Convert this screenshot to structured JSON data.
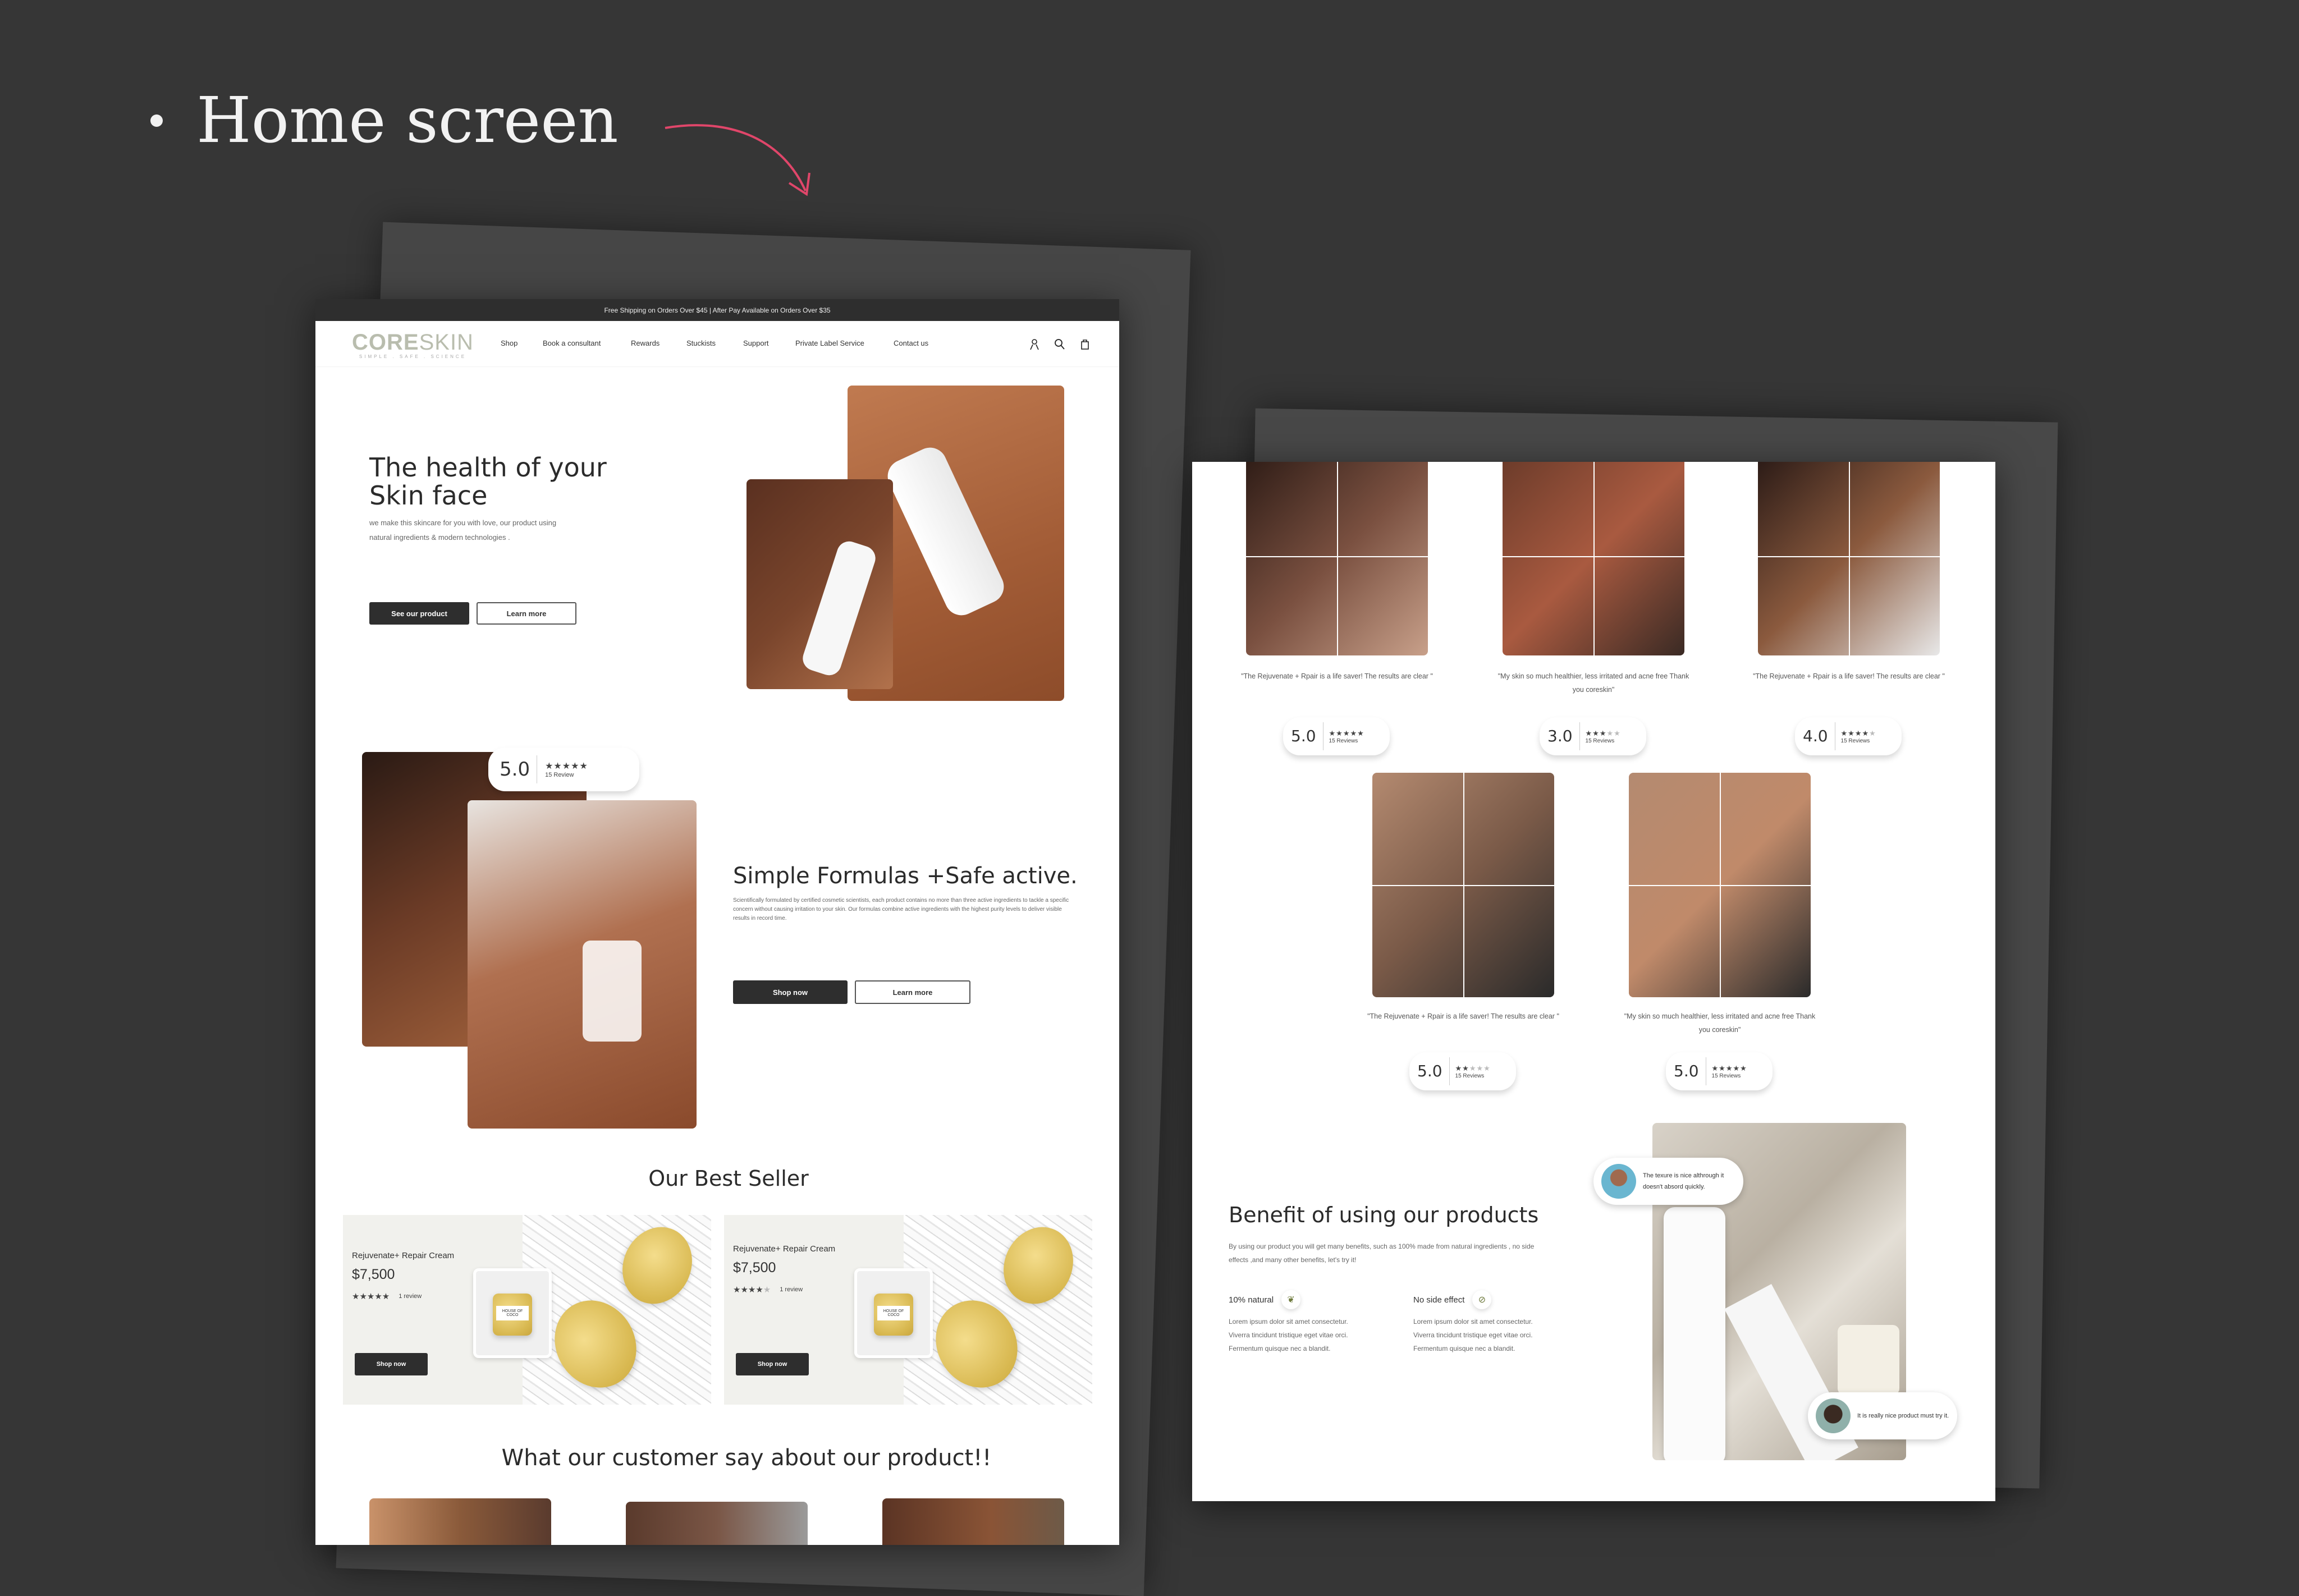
{
  "slide": {
    "title": "Home screen",
    "accent": "#e0466a"
  },
  "home": {
    "announcement": "Free Shipping on Orders Over $45 | After Pay Available on Orders Over $35",
    "logo": {
      "bold": "CORE",
      "light": "SKIN",
      "tagline": "SIMPLE . SAFE . SCIENCE"
    },
    "nav": [
      "Shop",
      "Book a consultant",
      "Rewards",
      "Stuckists",
      "Support",
      "Private Label Service",
      "Contact us"
    ],
    "icons": [
      "user-icon",
      "search-icon",
      "bag-icon"
    ],
    "hero": {
      "title_line1": "The health of your",
      "title_line2": "Skin face",
      "subtitle_line1": "we make this skincare for you with love, our product using",
      "subtitle_line2": "natural ingredients & modern technologies .",
      "primary": "See our product",
      "secondary": "Learn more"
    },
    "formulas": {
      "rating": "5.0",
      "stars": 5,
      "reviews": "15 Review",
      "title": "Simple Formulas +Safe active.",
      "body": "Scientifically formulated by certified cosmetic scientists, each product contains no more than three active ingredients to tackle a specific concern without causing irritation to your skin. Our formulas combine active ingredients with the highest purity levels to deliver visible results in record time.",
      "primary": "Shop now",
      "secondary": "Learn more"
    },
    "best_seller": {
      "title": "Our Best Seller",
      "products": [
        {
          "name": "Rejuvenate+ Repair Cream",
          "price": "$7,500",
          "stars": 5,
          "reviews": "1 review",
          "button": "Shop now",
          "jar_label": "HOUSE OF COCO"
        },
        {
          "name": "Rejuvenate+ Repair Cream",
          "price": "$7,500",
          "stars": 4,
          "reviews": "1 review",
          "button": "Shop now",
          "jar_label": "HOUSE OF COCO"
        }
      ]
    },
    "testimonials_title": "What our customer say about our product!!"
  },
  "reviews_page": {
    "reviews": [
      {
        "quote": "\"The Rejuvenate + Rpair is a life saver! The results are clear \"",
        "rating": "5.0",
        "stars": 5,
        "count": "15 Reviews"
      },
      {
        "quote": "\"My skin so much healthier, less irritated and acne free Thank you coreskin\"",
        "rating": "3.0",
        "stars": 3,
        "count": "15 Reviews"
      },
      {
        "quote": "\"The Rejuvenate + Rpair is a life saver! The results are clear \"",
        "rating": "4.0",
        "stars": 4,
        "count": "15 Reviews"
      },
      {
        "quote": "\"The Rejuvenate + Rpair is a life saver! The results are clear \"",
        "rating": "5.0",
        "stars": 2,
        "count": "15 Reviews"
      },
      {
        "quote": "\"My skin so much healthier, less irritated and acne free Thank you coreskin\"",
        "rating": "5.0",
        "stars": 5,
        "count": "15 Reviews"
      }
    ],
    "benefit": {
      "title": "Benefit of using our products",
      "body": "By using our product you will get many benefits, such as 100% made from natural ingredients , no side effects ,and many other benefits, let's try it!",
      "features": [
        {
          "title": "10% natural",
          "icon": "sprout-icon",
          "text": "Lorem ipsum dolor sit amet consectetur. Viverra tincidunt tristique eget vitae orci. Fermentum quisque nec a blandit."
        },
        {
          "title": "No side effect",
          "icon": "no-sign-icon",
          "text": "Lorem ipsum dolor sit amet consectetur. Viverra tincidunt tristique eget vitae orci. Fermentum quisque nec a blandit."
        }
      ],
      "bubble1": "The texure is nice althrough it doesn't absord quickly.",
      "bubble2": "It is really nice product must try it."
    }
  }
}
